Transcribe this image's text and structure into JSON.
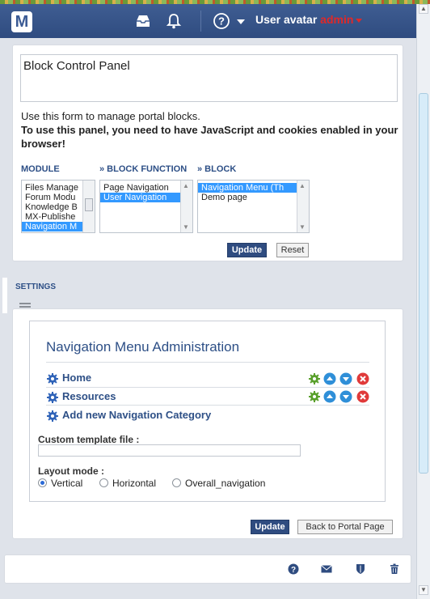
{
  "navbar": {
    "logo_letter": "M",
    "user_label": "User avatar",
    "username": "admin"
  },
  "block_panel": {
    "title_value": "Block Control Panel",
    "help_text": "Use this form to manage portal blocks.",
    "warning_text": "To use this panel, you need to have JavaScript and cookies enabled in your browser!",
    "columns": {
      "module": {
        "label": "MODULE",
        "options": [
          "Files Manage",
          "Forum Modu",
          "Knowledge B",
          "MX-Publishe",
          "Navigation M"
        ],
        "selected": "Navigation M"
      },
      "function": {
        "label": "» BLOCK FUNCTION",
        "options": [
          "Page Navigation",
          "User Navigation"
        ],
        "selected": "User Navigation"
      },
      "block": {
        "label": "» BLOCK",
        "options": [
          "Navigation Menu (Th",
          "Demo page"
        ],
        "selected": "Navigation Menu (Th"
      }
    },
    "update_label": "Update",
    "reset_label": "Reset"
  },
  "settings": {
    "label": "SETTINGS",
    "admin_title": "Navigation Menu Administration",
    "categories": [
      {
        "label": "Home"
      },
      {
        "label": "Resources"
      }
    ],
    "add_category_label": "Add new Navigation Category",
    "template_label": "Custom template file :",
    "template_value": "",
    "layout_label": "Layout mode :",
    "layout_options": [
      "Vertical",
      "Horizontal",
      "Overall_navigation"
    ],
    "layout_selected": "Vertical",
    "update_label": "Update",
    "back_label": "Back to Portal Page"
  },
  "colors": {
    "navbar": "#3f5d92",
    "accent": "#2d4f86",
    "selection": "#3399ff",
    "admin": "#e02828",
    "gear": "#5aa02c",
    "up_down": "#2f8fd8",
    "delete": "#e03a3a"
  },
  "icons": {
    "navbar": [
      "inbox-icon",
      "bell-icon",
      "help-icon"
    ],
    "footer": [
      "help-icon",
      "mail-icon",
      "shield-icon",
      "trash-icon"
    ]
  }
}
